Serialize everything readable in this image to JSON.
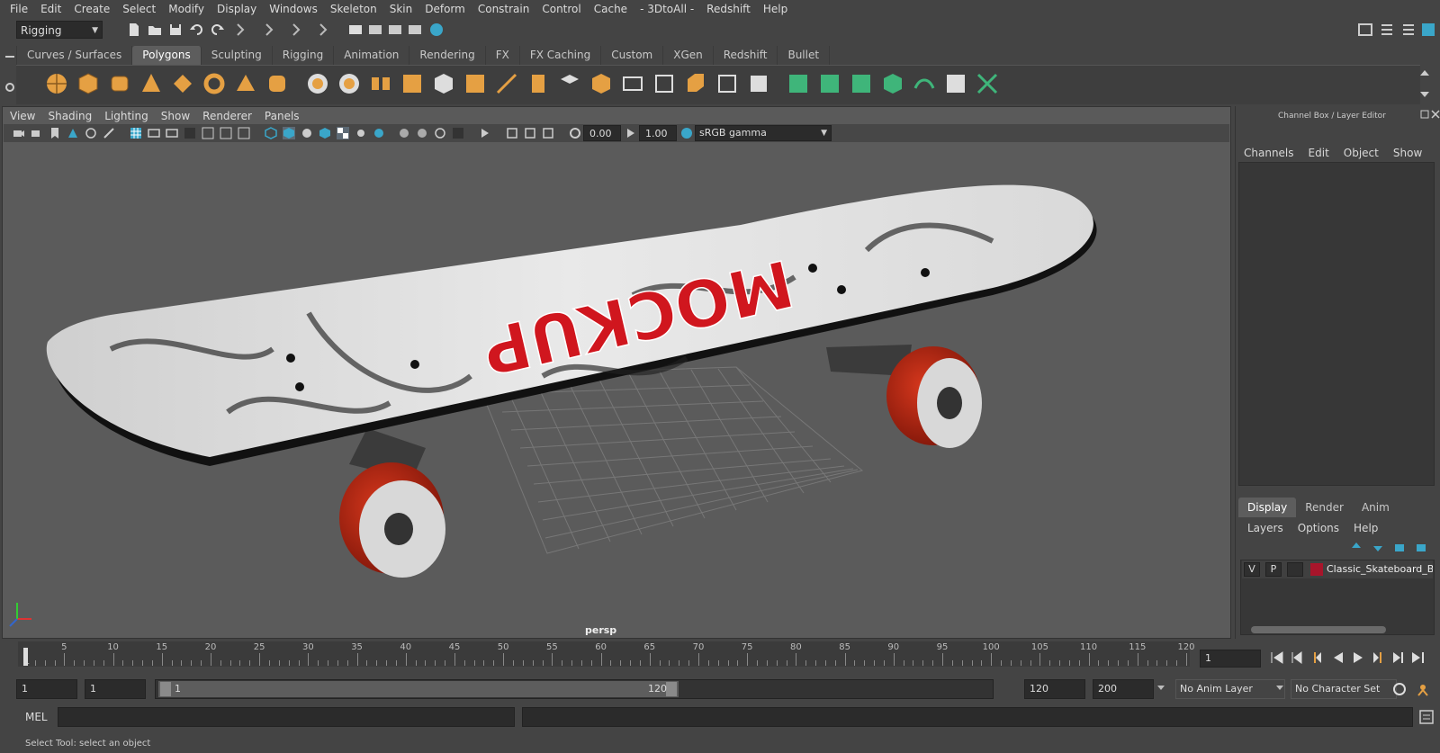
{
  "menubar": [
    "File",
    "Edit",
    "Create",
    "Select",
    "Modify",
    "Display",
    "Windows",
    "Skeleton",
    "Skin",
    "Deform",
    "Constrain",
    "Control",
    "Cache",
    "- 3DtoAll -",
    "Redshift",
    "Help"
  ],
  "status": {
    "mode": "Rigging"
  },
  "shelf": {
    "tabs": [
      "Curves / Surfaces",
      "Polygons",
      "Sculpting",
      "Rigging",
      "Animation",
      "Rendering",
      "FX",
      "FX Caching",
      "Custom",
      "XGen",
      "Redshift",
      "Bullet"
    ],
    "active_tab": "Polygons"
  },
  "viewport": {
    "menu": [
      "View",
      "Shading",
      "Lighting",
      "Show",
      "Renderer",
      "Panels"
    ],
    "exposure": "0.00",
    "gamma": "1.00",
    "color_space": "sRGB gamma",
    "camera_label": "persp",
    "graphic_text": "MOCKUP"
  },
  "channelbox": {
    "title": "Channel Box / Layer Editor",
    "menu": [
      "Channels",
      "Edit",
      "Object",
      "Show"
    ],
    "layer_tabs": [
      "Display",
      "Render",
      "Anim"
    ],
    "layer_menu": [
      "Layers",
      "Options",
      "Help"
    ],
    "layer": {
      "v": "V",
      "p": "P",
      "name": "Classic_Skateboard_Black",
      "color": "#a8152b"
    }
  },
  "timeline": {
    "ticks": [
      "1",
      "5",
      "10",
      "15",
      "20",
      "25",
      "30",
      "35",
      "40",
      "45",
      "50",
      "55",
      "60",
      "65",
      "70",
      "75",
      "80",
      "85",
      "90",
      "95",
      "100",
      "105",
      "110",
      "115",
      "120"
    ],
    "current_frame": "1"
  },
  "range": {
    "start_field": "1",
    "start_inner": "1",
    "range_start": "1",
    "range_end": "120",
    "end_field": "120",
    "anim_end": "200",
    "anim_layer": "No Anim Layer",
    "char_set": "No Character Set"
  },
  "cmdline": {
    "label": "MEL"
  },
  "helpline": "Select Tool: select an object",
  "colors": {
    "accent": "#5d5d5d",
    "wheel": "#b8240f",
    "deck_text": "#d0161e",
    "bg": "#444444"
  }
}
